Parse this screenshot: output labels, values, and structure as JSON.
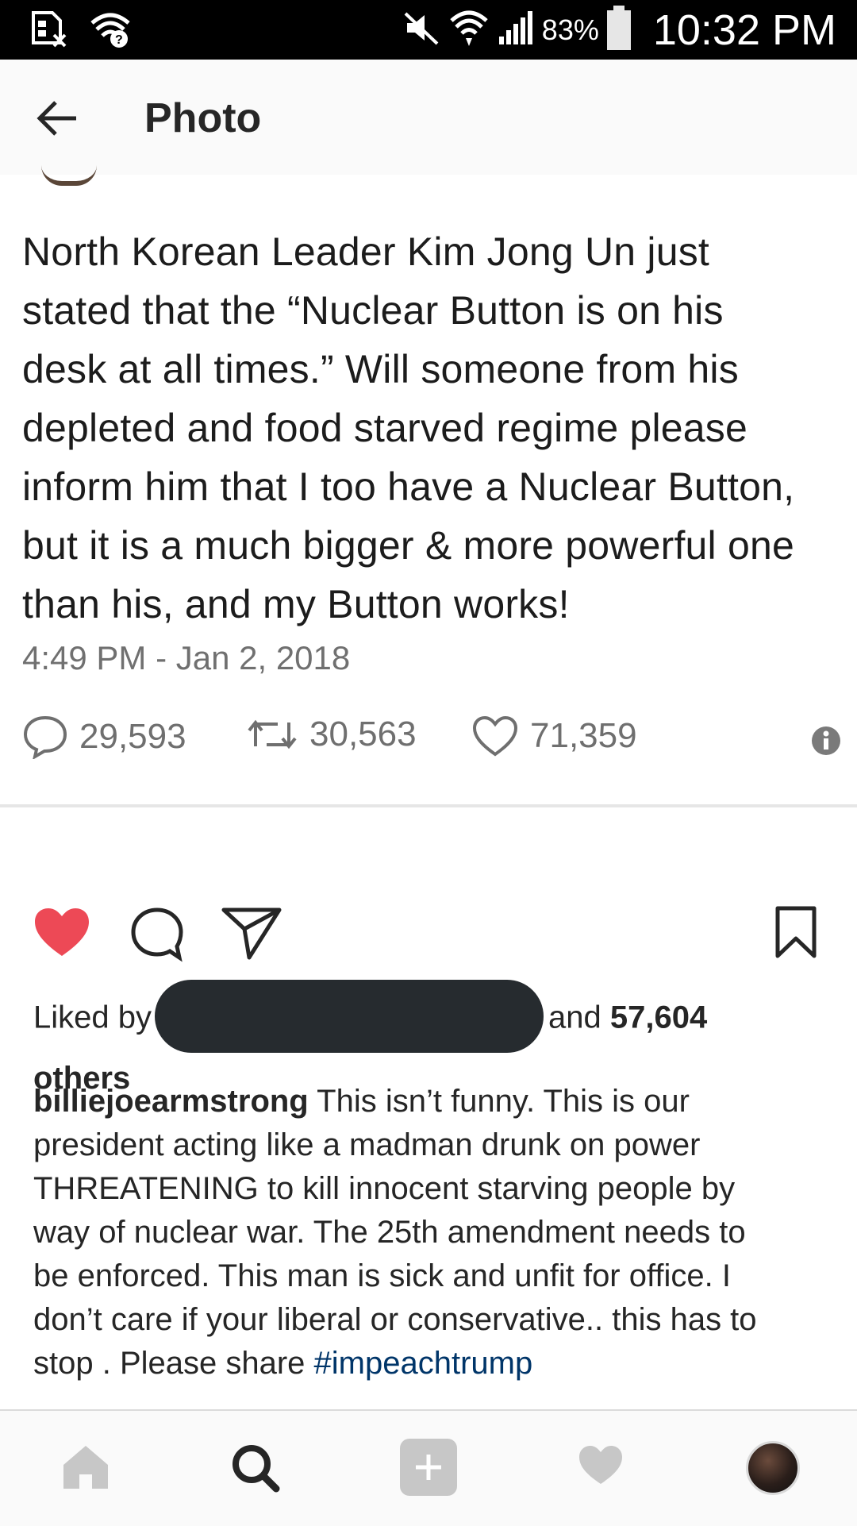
{
  "status_bar": {
    "battery": "83%",
    "time": "10:32 PM"
  },
  "app_bar": {
    "title": "Photo"
  },
  "tweet": {
    "text_lines": [
      "North Korean Leader Kim Jong Un just",
      "stated that the “Nuclear Button is on his",
      "desk at all times.” Will someone from his",
      "depleted and food starved regime please",
      "inform him that I too have a Nuclear Button,",
      "but it is a much bigger & more powerful one",
      "than his, and my Button works!"
    ],
    "timestamp": "4:49 PM - Jan 2, 2018",
    "replies": "29,593",
    "retweets": "30,563",
    "likes": "71,359"
  },
  "post": {
    "liked_by_prefix": "Liked by",
    "liked_and": "and",
    "liked_count": "57,604",
    "liked_suffix": "others",
    "username": "billiejoearmstrong",
    "caption_lines": [
      " This isn’t funny. This is our",
      "president acting like a madman drunk on power",
      "THREATENING to kill innocent starving people by",
      "way of nuclear war. The 25th amendment needs to",
      "be enforced. This man is sick and unfit for office. I",
      "don’t care if your liberal or conservative.. this has to",
      "stop . Please share "
    ],
    "hashtag": "#impeachtrump"
  },
  "icons": {
    "status_left": [
      "sim-off-icon",
      "wifi-question-icon"
    ],
    "status_right": [
      "mute-icon",
      "wifi-icon",
      "signal-icon",
      "battery-icon"
    ],
    "actions": [
      "heart-icon",
      "comment-icon",
      "share-icon",
      "bookmark-icon"
    ],
    "nav": [
      "home-icon",
      "search-icon",
      "add-icon",
      "activity-heart-icon",
      "profile-avatar"
    ]
  },
  "colors": {
    "like_red": "#ed4956",
    "hashtag_blue": "#003569",
    "status_bar": "#000000",
    "nav_inactive": "#c7c7c7"
  }
}
